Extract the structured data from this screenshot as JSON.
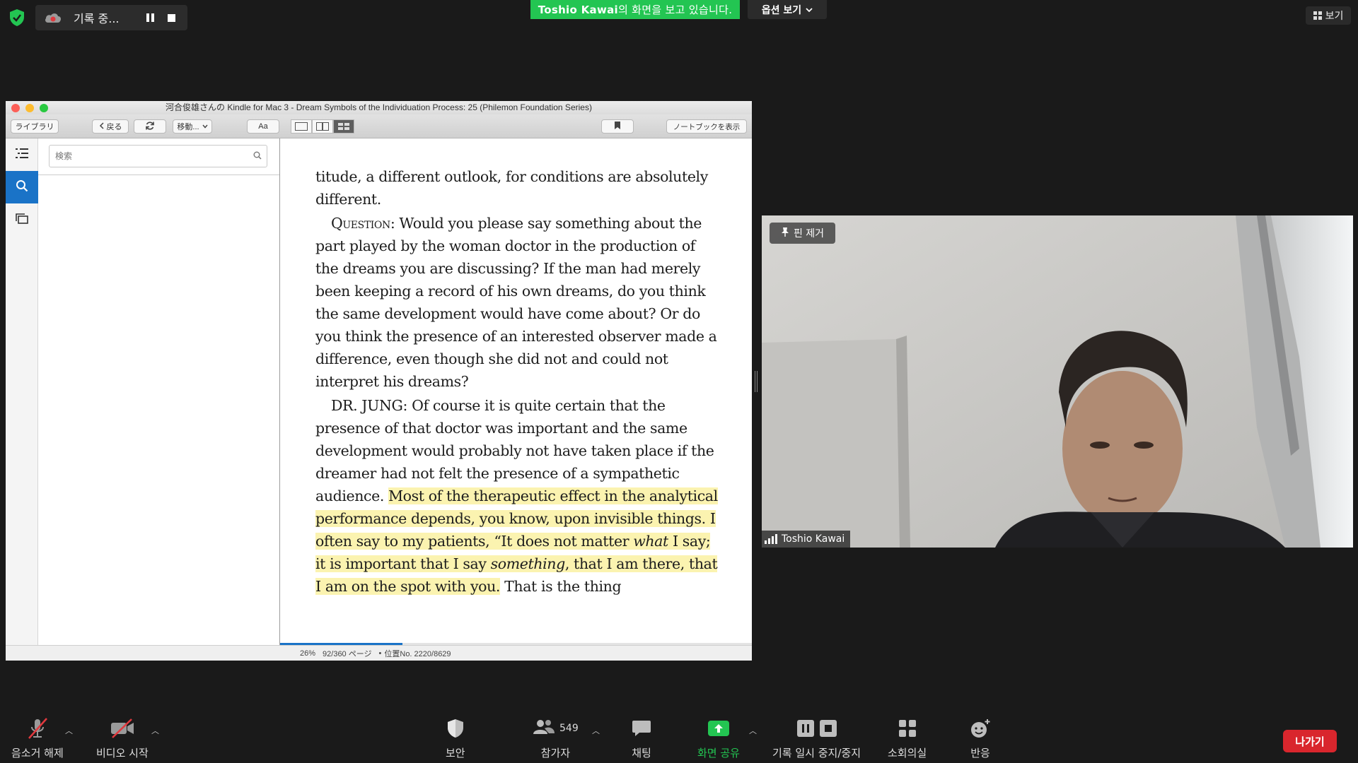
{
  "recording": {
    "label": "기록 중..."
  },
  "share_banner": {
    "name": "Toshio Kawai",
    "suffix": "의 화면을 보고 있습니다."
  },
  "options": {
    "label": "옵션 보기"
  },
  "view": {
    "label": "보기"
  },
  "kindle": {
    "window_title": "河合俊雄さんの Kindle for Mac 3 - Dream Symbols of the Individuation Process: 25 (Philemon Foundation Series)",
    "toolbar": {
      "library": "ライブラリ",
      "back": "戻る",
      "goto": "移動...",
      "font": "Aa",
      "notebook": "ノートブックを表示"
    },
    "search": {
      "placeholder": "検索",
      "value": ""
    },
    "page": {
      "p1": "titude, a different outlook, for conditions are absolutely different.",
      "p2_label": "Question",
      "p2": ": Would you please say something about the part played by the woman doctor in the production of the dreams you are discussing? If the man had merely been keeping a record of his own dreams, do you think the same development would have come about? Or do you think the presence of an interested observer made a difference, even though she did not and could not interpret his dreams?",
      "p3_start": "DR. JUNG: Of course it is quite certain that the presence of that doctor was important and the same development would probably not have taken place if the dreamer had not felt the presence of a sympathetic audience. ",
      "p3_hl1": "Most of the therapeutic effect in the analytical performance depends, you know, upon invisible things. I often say to my patients, “It does not matter ",
      "p3_hl_what": "what",
      "p3_hl2": " I say; it is important that I say ",
      "p3_hl_something": "something",
      "p3_hl3": ", that I am there, that I am on the spot with you.",
      "p3_end": " That is the thing"
    },
    "status": {
      "percent": "26%",
      "pages": "92/360 ページ",
      "bullet": "•",
      "location": "位置No. 2220/8629"
    },
    "progress_fraction": 0.26
  },
  "video": {
    "pin_label": "핀 제거",
    "participant_name": "Toshio Kawai"
  },
  "bottom_bar": {
    "unmute": "음소거 해제",
    "start_video": "비디오 시작",
    "security": "보안",
    "participants": "참가자",
    "participant_count": "549",
    "chat": "채팅",
    "share_screen": "화면 공유",
    "pause_stop_recording": "기록 일시 중지/중지",
    "breakout_rooms": "소회의실",
    "reactions": "반응",
    "leave": "나가기"
  },
  "colors": {
    "share_green": "#23c552",
    "leave_red": "#d9262d",
    "kindle_accent": "#1a73c7",
    "highlight": "#fbf3b0"
  }
}
